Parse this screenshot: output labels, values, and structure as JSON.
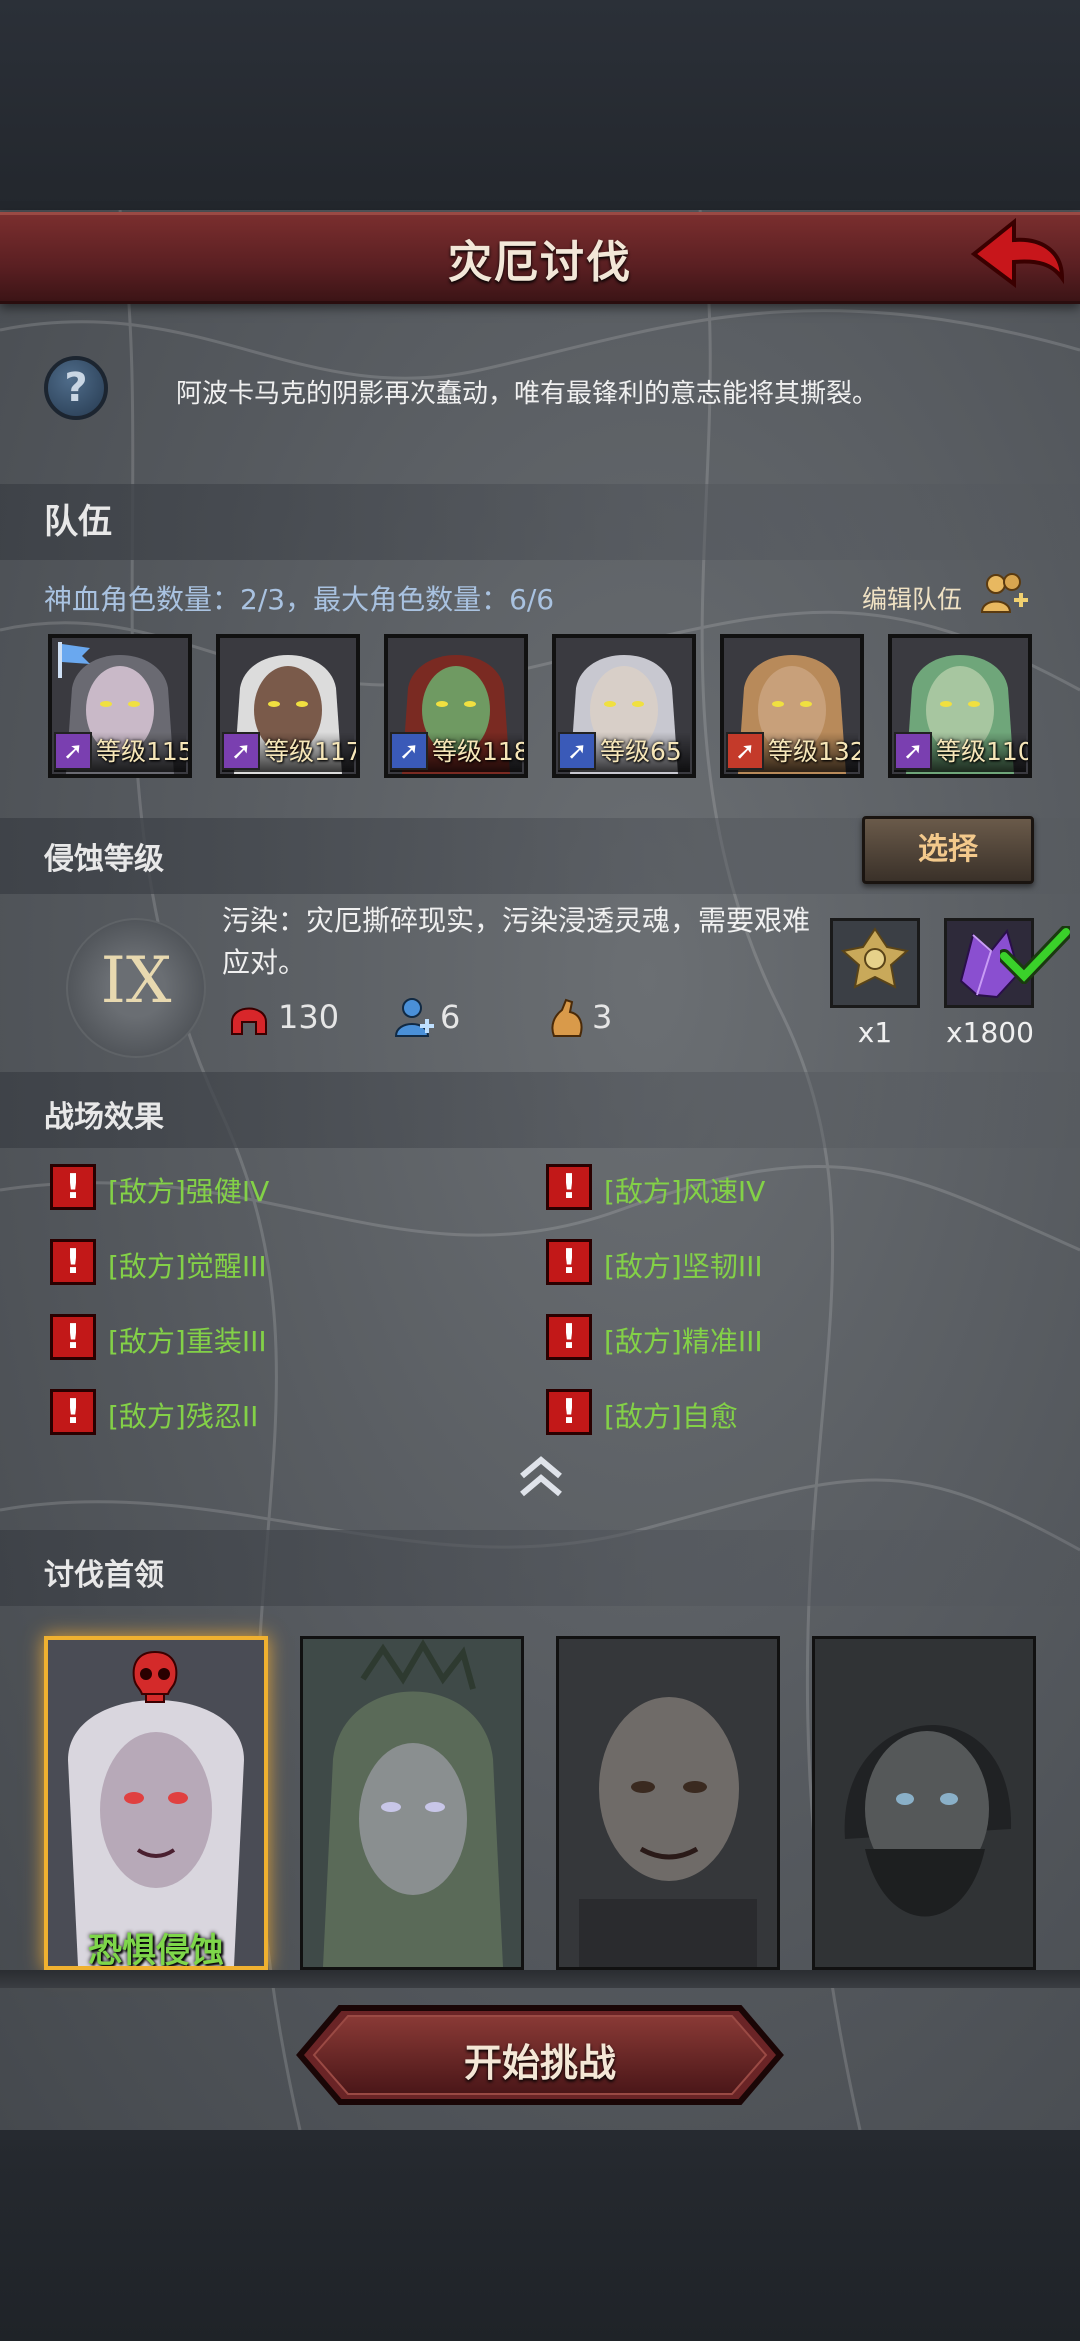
{
  "header": {
    "title": "灾厄讨伐",
    "back_icon": "back-arrow-icon"
  },
  "description": "阿波卡马克的阴影再次蠢动，唯有最锋利的意志能将其撕裂。",
  "team": {
    "title": "队伍",
    "stats": "神血角色数量：2/3，最大角色数量：6/6",
    "edit_label": "编辑队伍",
    "heroes": [
      {
        "level": "等级115",
        "class_icon": "staff-icon",
        "class_color": "#7a3fb0",
        "flag": true
      },
      {
        "level": "等级117",
        "class_icon": "staff-icon",
        "class_color": "#7a3fb0",
        "flag": false
      },
      {
        "level": "等级118",
        "class_icon": "sword-icon",
        "class_color": "#3a5ab8",
        "flag": false
      },
      {
        "level": "等级65",
        "class_icon": "sword-icon",
        "class_color": "#3a5ab8",
        "flag": false
      },
      {
        "level": "等级132",
        "class_icon": "beast-icon",
        "class_color": "#c43a2a",
        "flag": false
      },
      {
        "level": "等级110",
        "class_icon": "staff-icon",
        "class_color": "#7a3fb0",
        "flag": false
      }
    ]
  },
  "corruption": {
    "title": "侵蚀等级",
    "select_label": "选择",
    "level": "IX",
    "text": "污染：灾厄撕碎现实，污染浸透灵魂，需要艰难应对。",
    "stats": [
      {
        "icon": "helmet-icon",
        "value": "130"
      },
      {
        "icon": "ally-plus-icon",
        "value": "6"
      },
      {
        "icon": "hand-icon",
        "value": "3"
      }
    ],
    "rewards": [
      {
        "icon": "emblem-icon",
        "count": "x1"
      },
      {
        "icon": "crystal-icon",
        "count": "x1800",
        "checked": true
      }
    ]
  },
  "battlefield": {
    "title": "战场效果",
    "effects": [
      "[敌方]强健IV",
      "[敌方]风速IV",
      "[敌方]觉醒III",
      "[敌方]坚韧III",
      "[敌方]重装III",
      "[敌方]精准III",
      "[敌方]残忍II",
      "[敌方]自愈"
    ]
  },
  "bosses": {
    "title": "讨伐首领",
    "active_name": "恐惧侵蚀"
  },
  "start_label": "开始挑战"
}
